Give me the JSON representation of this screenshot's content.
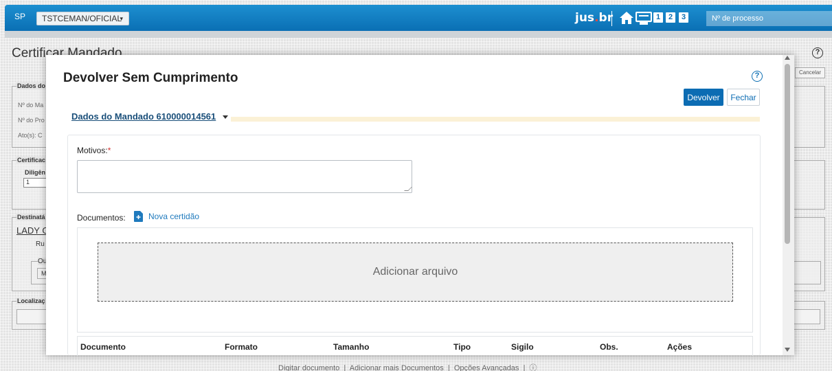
{
  "topbar": {
    "state": "SP",
    "court_select": "TSTCEMAN/OFICIAL",
    "logo_main": "jus",
    "logo_dot": ".",
    "logo_tld": "br",
    "shortcuts": [
      "1",
      "2",
      "3"
    ],
    "process_placeholder": "Nº de processo"
  },
  "background_page": {
    "title": "Certificar Mandado",
    "cancel_label": "Cancelar",
    "sections": {
      "dados": "Dados do",
      "certificacao": "Certificac",
      "destinatario": "Destinatá",
      "localizacao": "Localizaç"
    },
    "fields": {
      "num_mandado": "Nº do Ma",
      "num_processo": "Nº do Pro",
      "atos": "Ato(s): C",
      "diligencia": "Diligên",
      "diligencia_value": "1",
      "destinatario_name": "LADY G",
      "rua": "Ru",
      "outros": "Ou",
      "m": "M"
    },
    "footer": {
      "digitar": "Digitar documento",
      "sep1": "|",
      "adicionar": "Adicionar mais Documentos",
      "sep2": "|",
      "opcoes": "Opções Avançadas",
      "sep3": "|"
    }
  },
  "modal": {
    "title": "Devolver Sem Cumprimento",
    "devolver_label": "Devolver",
    "fechar_label": "Fechar",
    "dados_link": "Dados do Mandado 610000014561",
    "motivos_label": "Motivos:",
    "required_mark": "*",
    "documentos_label": "Documentos:",
    "nova_certidao": "Nova certidão",
    "dropzone_text": "Adicionar arquivo",
    "table_headers": [
      "Documento",
      "Formato",
      "Tamanho",
      "Tipo",
      "Sigilo",
      "Obs.",
      "Ações"
    ]
  },
  "colors": {
    "topbar": "#0a6fb4",
    "primary_button": "#0c6cb3",
    "link": "#1f7abd",
    "required": "#d3302f",
    "logo_dot": "#e8483d"
  }
}
